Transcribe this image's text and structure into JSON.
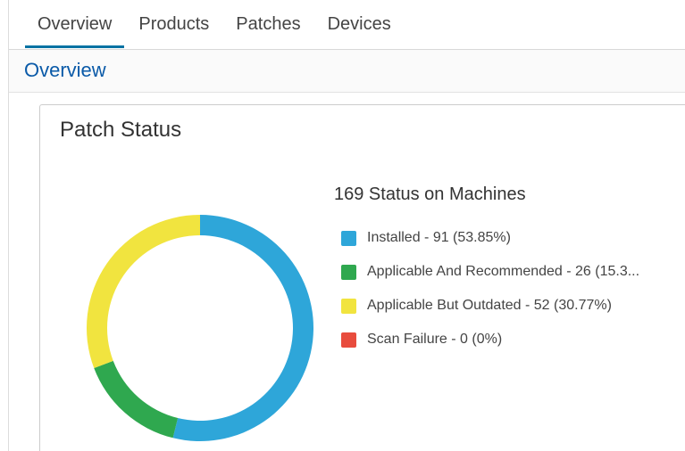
{
  "tabs": [
    {
      "label": "Overview",
      "active": true
    },
    {
      "label": "Products",
      "active": false
    },
    {
      "label": "Patches",
      "active": false
    },
    {
      "label": "Devices",
      "active": false
    }
  ],
  "header": {
    "title": "Overview"
  },
  "card": {
    "title": "Patch Status",
    "legend_title": "169 Status on Machines",
    "legend": [
      {
        "label": "Installed - 91 (53.85%)",
        "color": "#2ea6d9"
      },
      {
        "label": "Applicable And Recommended - 26 (15.3...",
        "color": "#2fa84f"
      },
      {
        "label": "Applicable But Outdated - 52 (30.77%)",
        "color": "#f1e43f"
      },
      {
        "label": "Scan Failure - 0 (0%)",
        "color": "#e84c3d"
      }
    ]
  },
  "chart_data": {
    "type": "pie",
    "title": "169 Status on Machines",
    "categories": [
      "Installed",
      "Applicable And Recommended",
      "Applicable But Outdated",
      "Scan Failure"
    ],
    "values": [
      91,
      26,
      52,
      0
    ],
    "colors": [
      "#2ea6d9",
      "#2fa84f",
      "#f1e43f",
      "#e84c3d"
    ],
    "donut": true,
    "legend": "right"
  }
}
